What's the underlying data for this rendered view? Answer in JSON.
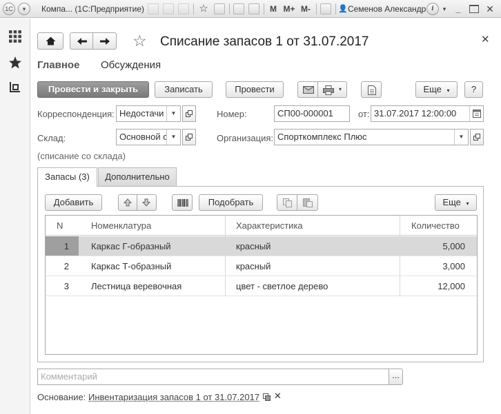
{
  "titlebar": {
    "app_title": "Компа... (1С:Предприятие)",
    "m_label": "M",
    "mplus_label": "M+",
    "mminus_label": "M-",
    "user_name": "Семенов Александр",
    "info_label": "i"
  },
  "document": {
    "title": "Списание запасов 1 от 31.07.2017",
    "nav": {
      "main": "Главное",
      "discussions": "Обсуждения"
    }
  },
  "toolbar": {
    "post_close": "Провести и закрыть",
    "save": "Записать",
    "post": "Провести",
    "more": "Еще",
    "help": "?"
  },
  "form": {
    "correspondence_label": "Корреспонденция:",
    "correspondence_value": "Недостачи",
    "number_label": "Номер:",
    "number_value": "СП00-000001",
    "date_label": "от:",
    "date_value": "31.07.2017 12:00:00",
    "warehouse_label": "Склад:",
    "warehouse_value": "Основной с",
    "organization_label": "Организация:",
    "organization_value": "Спорткомплекс Плюс",
    "note": "(списание со склада)"
  },
  "tabs": [
    {
      "label": "Запасы (3)",
      "active": true
    },
    {
      "label": "Дополнительно",
      "active": false
    }
  ],
  "table_toolbar": {
    "add": "Добавить",
    "select": "Подобрать",
    "more": "Еще"
  },
  "table": {
    "columns": [
      "N",
      "Номенклатура",
      "Характеристика",
      "Количество"
    ],
    "rows": [
      {
        "n": "1",
        "item": "Каркас Г-образный",
        "characteristic": "красный",
        "qty": "5,000",
        "selected": true
      },
      {
        "n": "2",
        "item": "Каркас Т-образный",
        "characteristic": "красный",
        "qty": "3,000",
        "selected": false
      },
      {
        "n": "3",
        "item": "Лестница веревочная",
        "characteristic": "цвет - светлое дерево",
        "qty": "12,000",
        "selected": false
      }
    ]
  },
  "comment": {
    "placeholder": "Комментарий",
    "button": "..."
  },
  "basis": {
    "label": "Основание:",
    "link": "Инвентаризация запасов 1 от 31.07.2017"
  }
}
